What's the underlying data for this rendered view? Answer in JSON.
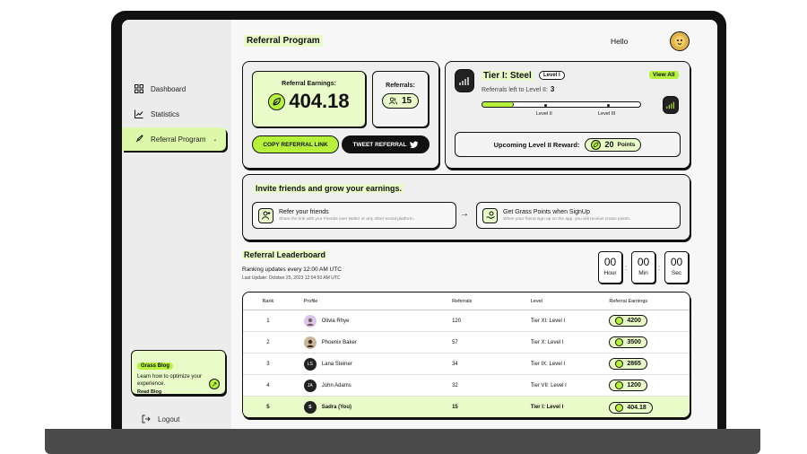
{
  "sidebar": {
    "items": [
      {
        "label": "Dashboard",
        "icon": "grid-icon"
      },
      {
        "label": "Statistics",
        "icon": "chart-icon"
      },
      {
        "label": "Referral Program",
        "icon": "rocket-icon"
      }
    ],
    "blog": {
      "tag": "Grass Blog",
      "text": "Learn how to optimize your experience.",
      "link": "Read Blog"
    },
    "logout": "Logout"
  },
  "header": {
    "title": "Referral Program",
    "greeting": "Hello"
  },
  "earnings": {
    "label": "Referral Earnings:",
    "value": "404.18"
  },
  "referrals": {
    "label": "Referrals:",
    "value": "15"
  },
  "actions": {
    "copy": "COPY REFERRAL LINK",
    "tweet": "TWEET REFERRAL"
  },
  "tier": {
    "title": "Tier I: Steel",
    "level": "Level I",
    "view_all": "View All",
    "left_label": "Referrals left to Level II:",
    "left_value": "3",
    "progress": 0.2,
    "marks": [
      "Level II",
      "Level III"
    ],
    "upcoming_label": "Upcoming Level II Reward:",
    "upcoming_value": "20",
    "upcoming_unit": "Points"
  },
  "invite": {
    "title": "Invite friends and grow your earnings.",
    "steps": [
      {
        "title": "Refer your friends",
        "sub": "Share the link with you Friends over twitter or any other social platform."
      },
      {
        "title": "Get Grass Points when SignUp",
        "sub": "When your friend sign up on the app, you will receive Grass points."
      }
    ]
  },
  "leaderboard": {
    "title": "Referral Leaderboard",
    "subtitle": "Ranking updates every 12:00 AM UTC",
    "last_update": "Last Update: October 25, 2023 12:04:50 AM UTC",
    "timer": [
      {
        "value": "00",
        "unit": "Hour"
      },
      {
        "value": "00",
        "unit": "Min"
      },
      {
        "value": "00",
        "unit": "Sec"
      }
    ],
    "columns": [
      "Rank",
      "Profile",
      "Referrals",
      "Level",
      "Referral Earnings"
    ],
    "rows": [
      {
        "rank": "1",
        "name": "Olivia Rhye",
        "initials": "",
        "referrals": "120",
        "level": "Tier XI: Level I",
        "earnings": "4200"
      },
      {
        "rank": "2",
        "name": "Phoenix Baker",
        "initials": "",
        "referrals": "57",
        "level": "Tier X: Level I",
        "earnings": "3500"
      },
      {
        "rank": "3",
        "name": "Lana Steiner",
        "initials": "LS",
        "referrals": "34",
        "level": "Tier IX: Level I",
        "earnings": "2865"
      },
      {
        "rank": "4",
        "name": "John Adams",
        "initials": "JA",
        "referrals": "32",
        "level": "Tier VII: Level I",
        "earnings": "1200"
      },
      {
        "rank": "5",
        "name": "Sadra (You)",
        "initials": "S",
        "referrals": "15",
        "level": "Tier I: Level I",
        "earnings": "404.18"
      }
    ]
  },
  "colors": {
    "accent": "#b6f23c",
    "accent_light": "#e8fbc8",
    "dark": "#111111"
  }
}
